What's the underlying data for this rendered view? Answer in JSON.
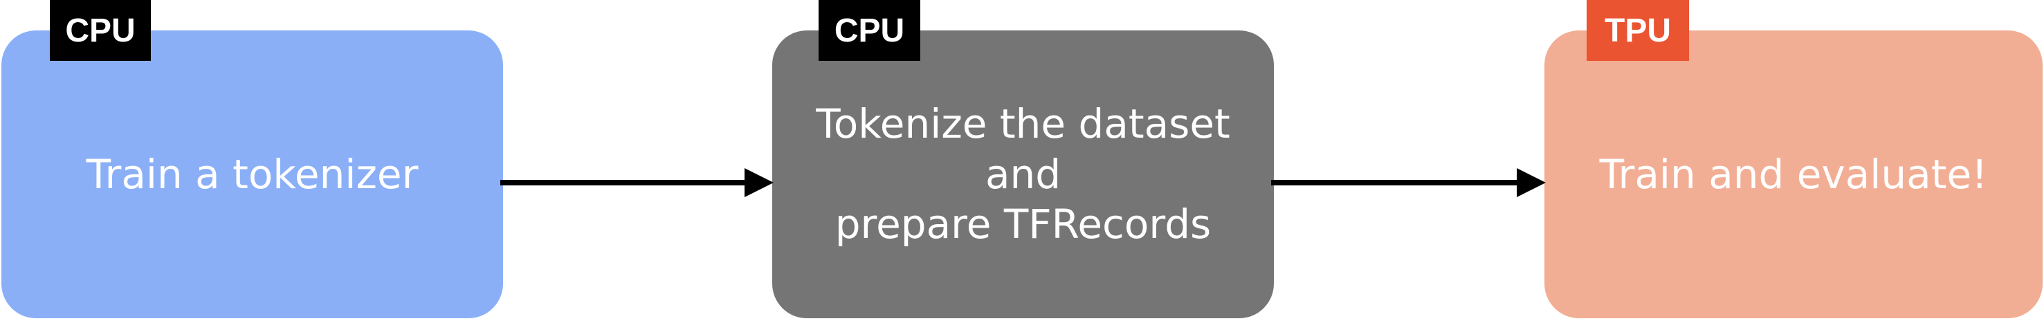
{
  "diagram": {
    "colors": {
      "box_blue": "#8aaff7",
      "box_gray": "#757575",
      "box_salmon": "#f2ae94",
      "badge_black": "#000000",
      "badge_orange": "#ea5430",
      "arrow": "#000000",
      "text": "#ffffff"
    },
    "steps": [
      {
        "label": "Train a tokenizer",
        "badge": "CPU",
        "color": "#8aaff7",
        "badge_color": "#000000"
      },
      {
        "label_line1": "Tokenize the dataset and",
        "label_line2": "prepare TFRecords",
        "badge": "CPU",
        "color": "#757575",
        "badge_color": "#000000"
      },
      {
        "label": "Train and evaluate!",
        "badge": "TPU",
        "color": "#f2ae94",
        "badge_color": "#ea5430"
      }
    ]
  }
}
